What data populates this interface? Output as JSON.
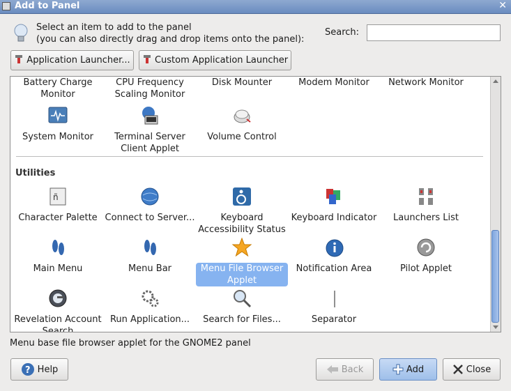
{
  "window": {
    "title": "Add to Panel"
  },
  "instructions": {
    "line1": "Select an item to add to the panel",
    "line2": "(you can also directly drag and drop items onto the panel):"
  },
  "search": {
    "label": "Search:",
    "value": ""
  },
  "launchers": {
    "app": "Application Launcher...",
    "custom": "Custom Application Launcher"
  },
  "list": {
    "top_items": [
      {
        "label": "Battery Charge Monitor",
        "icon": "battery-icon"
      },
      {
        "label": "CPU Frequency Scaling Monitor",
        "icon": "cpu-icon"
      },
      {
        "label": "Disk Mounter",
        "icon": "disk-icon"
      },
      {
        "label": "Modem Monitor",
        "icon": "modem-icon"
      },
      {
        "label": "Network Monitor",
        "icon": "network-icon"
      },
      {
        "label": "System Monitor",
        "icon": "system-monitor-icon"
      },
      {
        "label": "Terminal Server Client Applet",
        "icon": "terminal-server-icon"
      },
      {
        "label": "Volume Control",
        "icon": "volume-icon"
      }
    ],
    "section": "Utilities",
    "utility_items": [
      {
        "label": "Character Palette",
        "icon": "character-palette-icon"
      },
      {
        "label": "Connect to Server...",
        "icon": "globe-icon"
      },
      {
        "label": "Keyboard Accessibility Status",
        "icon": "accessibility-icon"
      },
      {
        "label": "Keyboard Indicator",
        "icon": "keyboard-flags-icon"
      },
      {
        "label": "Launchers List",
        "icon": "launchers-icon"
      },
      {
        "label": "Main Menu",
        "icon": "foot-icon"
      },
      {
        "label": "Menu Bar",
        "icon": "foot-icon"
      },
      {
        "label": "Menu File Browser Applet",
        "icon": "star-icon",
        "selected": true
      },
      {
        "label": "Notification Area",
        "icon": "info-icon"
      },
      {
        "label": "Pilot Applet",
        "icon": "pilot-icon"
      },
      {
        "label": "Revelation Account Search",
        "icon": "revelation-icon"
      },
      {
        "label": "Run Application...",
        "icon": "gears-icon"
      },
      {
        "label": "Search for Files...",
        "icon": "magnifier-icon"
      },
      {
        "label": "Separator",
        "icon": "separator-icon"
      }
    ]
  },
  "status": "Menu base file browser applet for the GNOME2 panel",
  "buttons": {
    "help": "Help",
    "back": "Back",
    "add": "Add",
    "close": "Close"
  },
  "colors": {
    "selection": "#86b3f0",
    "titlebar": "#7b9bcb"
  }
}
